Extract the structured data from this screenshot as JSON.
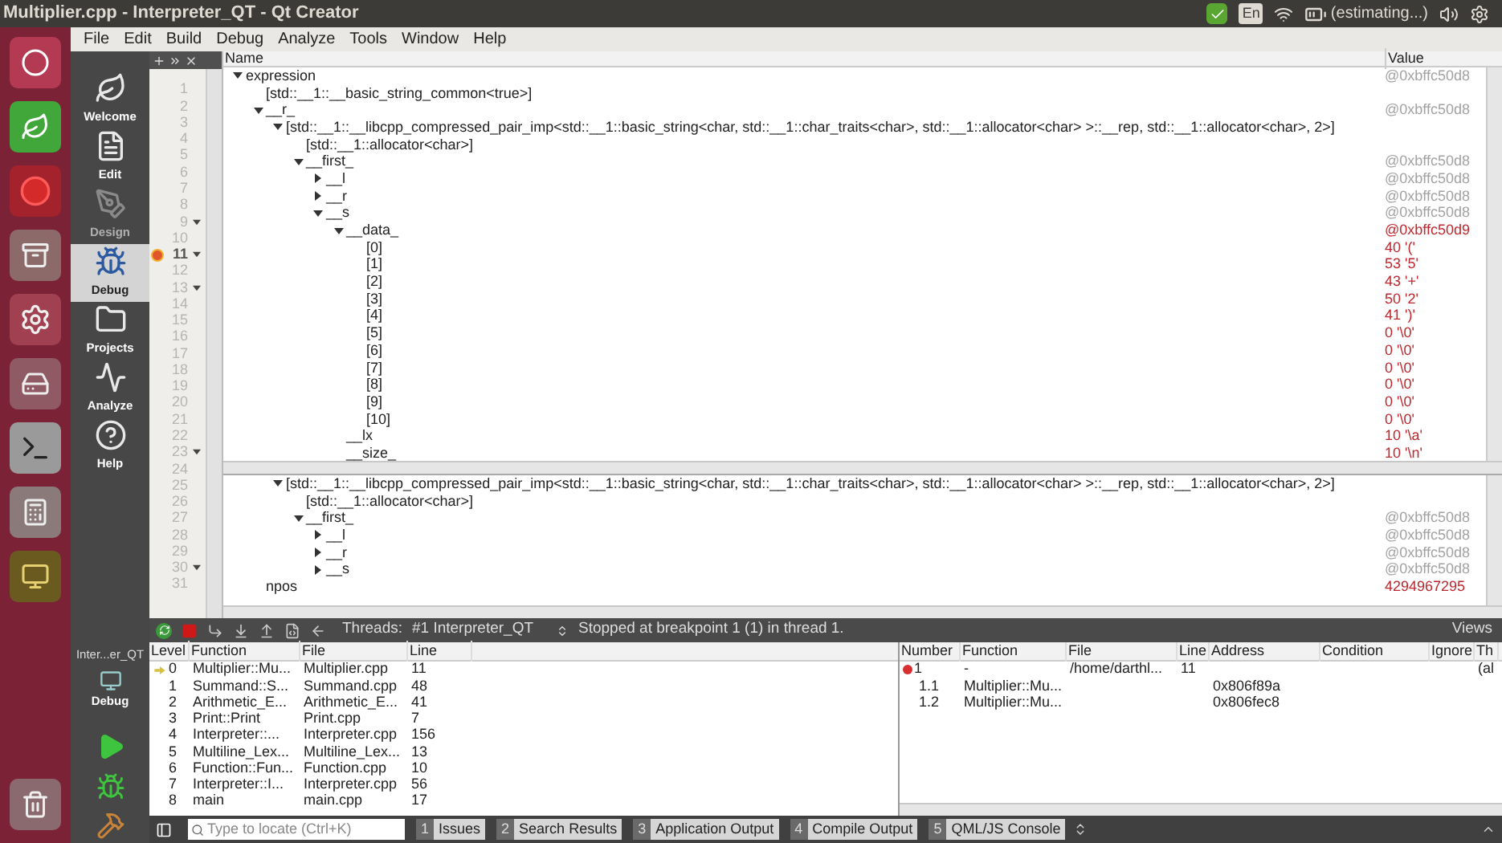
{
  "window": {
    "title": "Multiplier.cpp - Interpreter_QT - Qt Creator"
  },
  "tray": {
    "language": "En",
    "battery": "(estimating...)"
  },
  "menu": [
    "File",
    "Edit",
    "Build",
    "Debug",
    "Analyze",
    "Tools",
    "Window",
    "Help"
  ],
  "modes": [
    {
      "label": "Welcome",
      "selected": false,
      "disabled": false
    },
    {
      "label": "Edit",
      "selected": false,
      "disabled": false
    },
    {
      "label": "Design",
      "selected": false,
      "disabled": true
    },
    {
      "label": "Debug",
      "selected": true,
      "disabled": false
    },
    {
      "label": "Projects",
      "selected": false,
      "disabled": false
    },
    {
      "label": "Analyze",
      "selected": false,
      "disabled": false
    },
    {
      "label": "Help",
      "selected": false,
      "disabled": false
    }
  ],
  "target": {
    "project": "Inter...er_QT",
    "config": "Debug"
  },
  "editor": {
    "lines": [
      {
        "number": "1",
        "foldable": false,
        "breakpoint": false
      },
      {
        "number": "2",
        "foldable": false,
        "breakpoint": false
      },
      {
        "number": "3",
        "foldable": false,
        "breakpoint": false
      },
      {
        "number": "4",
        "foldable": false,
        "breakpoint": false
      },
      {
        "number": "5",
        "foldable": false,
        "breakpoint": false
      },
      {
        "number": "6",
        "foldable": false,
        "breakpoint": false
      },
      {
        "number": "7",
        "foldable": false,
        "breakpoint": false
      },
      {
        "number": "8",
        "foldable": false,
        "breakpoint": false
      },
      {
        "number": "9",
        "foldable": true,
        "breakpoint": false
      },
      {
        "number": "10",
        "foldable": false,
        "breakpoint": false
      },
      {
        "number": "11",
        "foldable": true,
        "breakpoint": true
      },
      {
        "number": "12",
        "foldable": false,
        "breakpoint": false
      },
      {
        "number": "13",
        "foldable": true,
        "breakpoint": false
      },
      {
        "number": "14",
        "foldable": false,
        "breakpoint": false
      },
      {
        "number": "15",
        "foldable": false,
        "breakpoint": false
      },
      {
        "number": "16",
        "foldable": false,
        "breakpoint": false
      },
      {
        "number": "17",
        "foldable": false,
        "breakpoint": false
      },
      {
        "number": "18",
        "foldable": false,
        "breakpoint": false
      },
      {
        "number": "19",
        "foldable": false,
        "breakpoint": false
      },
      {
        "number": "20",
        "foldable": false,
        "breakpoint": false
      },
      {
        "number": "21",
        "foldable": false,
        "breakpoint": false
      },
      {
        "number": "22",
        "foldable": false,
        "breakpoint": false
      },
      {
        "number": "23",
        "foldable": true,
        "breakpoint": false
      },
      {
        "number": "24",
        "foldable": false,
        "breakpoint": false
      },
      {
        "number": "25",
        "foldable": false,
        "breakpoint": false
      },
      {
        "number": "26",
        "foldable": false,
        "breakpoint": false
      },
      {
        "number": "27",
        "foldable": false,
        "breakpoint": false
      },
      {
        "number": "28",
        "foldable": false,
        "breakpoint": false
      },
      {
        "number": "29",
        "foldable": false,
        "breakpoint": false
      },
      {
        "number": "30",
        "foldable": true,
        "breakpoint": false
      },
      {
        "number": "31",
        "foldable": false,
        "breakpoint": false
      }
    ]
  },
  "locals": {
    "columns": [
      "Name",
      "Value"
    ],
    "upper_rows": [
      {
        "name": "expression",
        "value": "@0xbffc50d8",
        "changed": false,
        "expanded": true,
        "children": [
          {
            "name": "[std::__1::__basic_string_common<true>]"
          },
          {
            "name": "__r_",
            "value": "@0xbffc50d8",
            "changed": false,
            "expanded": true,
            "children": [
              {
                "name": "[std::__1::__libcpp_compressed_pair_imp<std::__1::basic_string<char, std::__1::char_traits<char>, std::__1::allocator<char> >::__rep, std::__1::allocator<char>, 2>]",
                "expanded": true,
                "children": [
                  {
                    "name": "[std::__1::allocator<char>]"
                  },
                  {
                    "name": "__first_",
                    "value": "@0xbffc50d8",
                    "changed": false,
                    "expanded": true,
                    "children": [
                      {
                        "name": "__l",
                        "value": "@0xbffc50d8",
                        "changed": false,
                        "expanded": false
                      },
                      {
                        "name": "__r",
                        "value": "@0xbffc50d8",
                        "changed": false,
                        "expanded": false
                      },
                      {
                        "name": "__s",
                        "value": "@0xbffc50d8",
                        "changed": false,
                        "expanded": true,
                        "children": [
                          {
                            "name": "__data_",
                            "value": "@0xbffc50d9",
                            "changed": true,
                            "expanded": true,
                            "children": [
                              {
                                "name": "[0]",
                                "value": "40 '('",
                                "changed": true
                              },
                              {
                                "name": "[1]",
                                "value": "53 '5'",
                                "changed": true
                              },
                              {
                                "name": "[2]",
                                "value": "43 '+'",
                                "changed": true
                              },
                              {
                                "name": "[3]",
                                "value": "50 '2'",
                                "changed": true
                              },
                              {
                                "name": "[4]",
                                "value": "41 ')'",
                                "changed": true
                              },
                              {
                                "name": "[5]",
                                "value": "0 '\\0'",
                                "changed": true
                              },
                              {
                                "name": "[6]",
                                "value": "0 '\\0'",
                                "changed": true
                              },
                              {
                                "name": "[7]",
                                "value": "0 '\\0'",
                                "changed": true
                              },
                              {
                                "name": "[8]",
                                "value": "0 '\\0'",
                                "changed": true
                              },
                              {
                                "name": "[9]",
                                "value": "0 '\\0'",
                                "changed": true
                              },
                              {
                                "name": "[10]",
                                "value": "0 '\\0'",
                                "changed": true
                              }
                            ]
                          },
                          {
                            "name": "__lx",
                            "value": "10 '\\a'",
                            "changed": true
                          },
                          {
                            "name": "__size_",
                            "value": "10 '\\n'",
                            "changed": true
                          }
                        ]
                      }
                    ]
                  }
                ]
              }
            ]
          }
        ]
      }
    ],
    "lower_rows": [
      {
        "children": [
          {
            "name": "[std::__1::__libcpp_compressed_pair_imp<std::__1::basic_string<char, std::__1::char_traits<char>, std::__1::allocator<char> >::__rep, std::__1::allocator<char>, 2>]",
            "expanded": true,
            "children": [
              {
                "name": "[std::__1::allocator<char>]"
              },
              {
                "name": "__first_",
                "value": "@0xbffc50d8",
                "changed": false,
                "expanded": true,
                "children": [
                  {
                    "name": "__l",
                    "value": "@0xbffc50d8",
                    "changed": false,
                    "expanded": false
                  },
                  {
                    "name": "__r",
                    "value": "@0xbffc50d8",
                    "changed": false,
                    "expanded": false
                  },
                  {
                    "name": "__s",
                    "value": "@0xbffc50d8",
                    "changed": false,
                    "expanded": false
                  }
                ]
              }
            ]
          }
        ]
      },
      {
        "name": "npos",
        "value": "4294967295",
        "changed": true
      }
    ]
  },
  "debug_toolbar": {
    "threads_label": "Threads:",
    "thread": "#1 Interpreter_QT",
    "status": "Stopped at breakpoint 1 (1) in thread 1.",
    "views": "Views"
  },
  "stack": {
    "columns": [
      "Level",
      "Function",
      "File",
      "Line"
    ],
    "rows": [
      {
        "level": "0",
        "function": "Multiplier::Mu...",
        "file": "Multiplier.cpp",
        "line": "11",
        "current": true
      },
      {
        "level": "1",
        "function": "Summand::S...",
        "file": "Summand.cpp",
        "line": "48",
        "current": false
      },
      {
        "level": "2",
        "function": "Arithmetic_E...",
        "file": "Arithmetic_E...",
        "line": "41",
        "current": false
      },
      {
        "level": "3",
        "function": "Print::Print",
        "file": "Print.cpp",
        "line": "7",
        "current": false
      },
      {
        "level": "4",
        "function": "Interpreter::...",
        "file": "Interpreter.cpp",
        "line": "156",
        "current": false
      },
      {
        "level": "5",
        "function": "Multiline_Lex...",
        "file": "Multiline_Lex...",
        "line": "13",
        "current": false
      },
      {
        "level": "6",
        "function": "Function::Fun...",
        "file": "Function.cpp",
        "line": "10",
        "current": false
      },
      {
        "level": "7",
        "function": "Interpreter::I...",
        "file": "Interpreter.cpp",
        "line": "56",
        "current": false
      },
      {
        "level": "8",
        "function": "main",
        "file": "main.cpp",
        "line": "17",
        "current": false
      }
    ]
  },
  "breakpoints": {
    "columns": [
      "Number",
      "Function",
      "File",
      "Line",
      "Address",
      "Condition",
      "Ignore",
      "Th"
    ],
    "rows": [
      {
        "kind": "breakpoint",
        "number": "1",
        "function": "-",
        "file": "/home/darthl...",
        "line": "11",
        "threads": "(al"
      },
      {
        "kind": "location",
        "number": "1.1",
        "function": "Multiplier::Mu...",
        "address": "0x806f89a"
      },
      {
        "kind": "location",
        "number": "1.2",
        "function": "Multiplier::Mu...",
        "address": "0x806fec8"
      }
    ]
  },
  "output_bar": {
    "locator_placeholder": "Type to locate (Ctrl+K)",
    "tabs": [
      {
        "number": "1",
        "label": "Issues"
      },
      {
        "number": "2",
        "label": "Search Results"
      },
      {
        "number": "3",
        "label": "Application Output"
      },
      {
        "number": "4",
        "label": "Compile Output"
      },
      {
        "number": "5",
        "label": "QML/JS Console"
      }
    ]
  }
}
